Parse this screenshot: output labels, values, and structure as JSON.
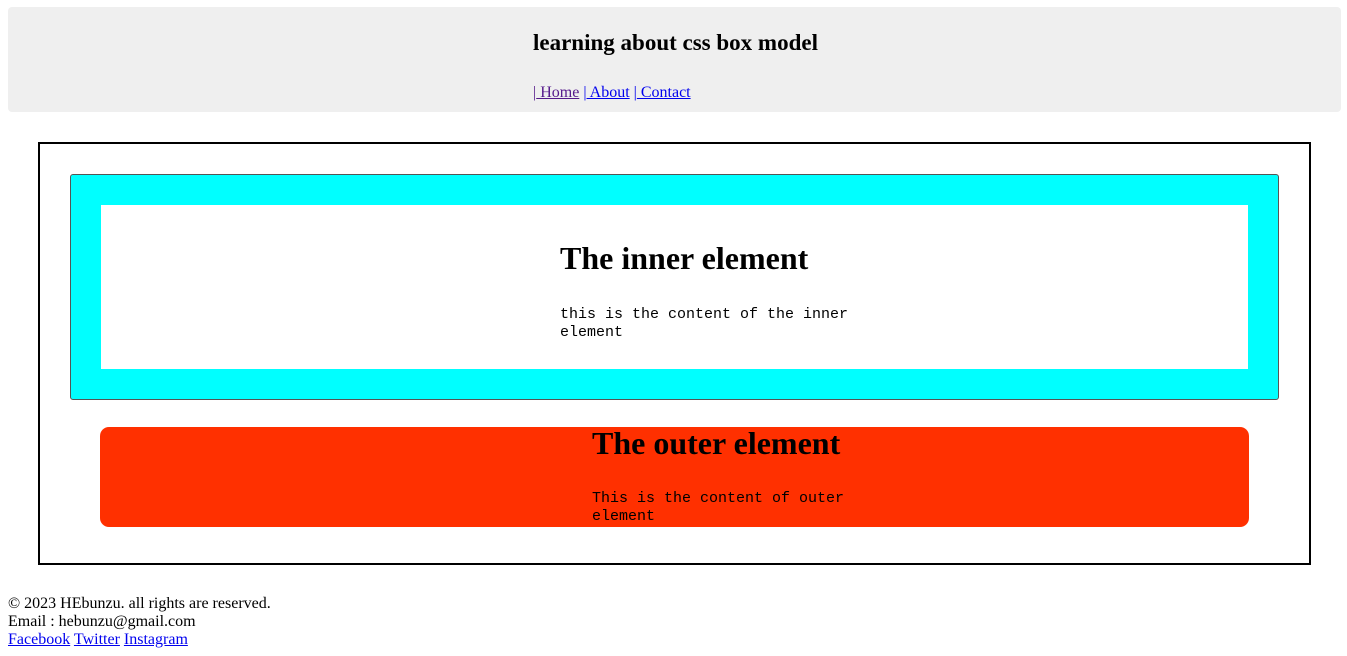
{
  "header": {
    "title": "learning about css box model",
    "nav": [
      {
        "sep": "|",
        "label": " Home"
      },
      {
        "sep": "|",
        "label": " About"
      },
      {
        "sep": "|",
        "label": " Contact"
      }
    ]
  },
  "inner": {
    "title": "The inner element",
    "content": "this is the content of the inner element"
  },
  "outer": {
    "title": "The outer element",
    "content": "This is the content of outer element"
  },
  "footer": {
    "copyright": "© 2023 HEbunzu. all rights are reserved.",
    "email": "Email : hebunzu@gmail.com",
    "links": [
      "Facebook",
      "Twitter",
      "Instagram"
    ]
  },
  "colors": {
    "header_bg": "#efefef",
    "inner_border": "#00ffff",
    "outer_bg": "#ff3000",
    "link": "#0000ee",
    "visited_link": "#551a8b"
  }
}
